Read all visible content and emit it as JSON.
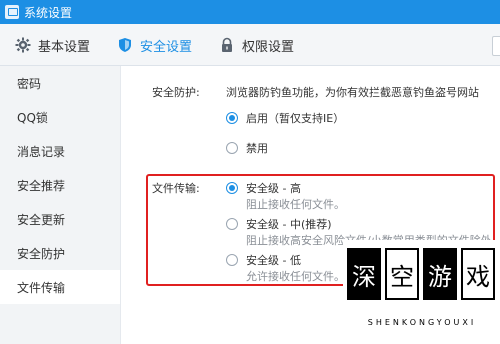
{
  "window": {
    "title": "系统设置"
  },
  "tabs": [
    {
      "label": "基本设置",
      "icon": "gear-icon",
      "active": false
    },
    {
      "label": "安全设置",
      "icon": "shield-icon",
      "active": true
    },
    {
      "label": "权限设置",
      "icon": "lock-icon",
      "active": false
    }
  ],
  "sidebar": {
    "items": [
      {
        "label": "密码",
        "active": false
      },
      {
        "label": "QQ锁",
        "active": false
      },
      {
        "label": "消息记录",
        "active": false
      },
      {
        "label": "安全推荐",
        "active": false
      },
      {
        "label": "安全更新",
        "active": false
      },
      {
        "label": "安全防护",
        "active": false
      },
      {
        "label": "文件传输",
        "active": true
      }
    ]
  },
  "security": {
    "label": "安全防护:",
    "description": "浏览器防钓鱼功能，为你有效拦截恶意钓鱼盗号网站",
    "options": [
      {
        "label": "启用（暂仅支持IE）",
        "checked": true
      },
      {
        "label": "禁用",
        "checked": false
      }
    ]
  },
  "file_transfer": {
    "label": "文件传输:",
    "options": [
      {
        "label": "安全级 - 高",
        "sub": "阻止接收任何文件。",
        "checked": true
      },
      {
        "label": "安全级 - 中(推荐)",
        "sub": "阻止接收高安全风险文件/小数常用类型的文件除外",
        "checked": false
      },
      {
        "label": "安全级 - 低",
        "sub": "允许接收任何文件。",
        "checked": false
      }
    ]
  },
  "watermark": {
    "chars": [
      "深",
      "空",
      "游",
      "戏"
    ],
    "subtitle": "SHENKONGYOUXI"
  },
  "colors": {
    "accent": "#1d8fe4",
    "highlight_border": "#e02020"
  }
}
